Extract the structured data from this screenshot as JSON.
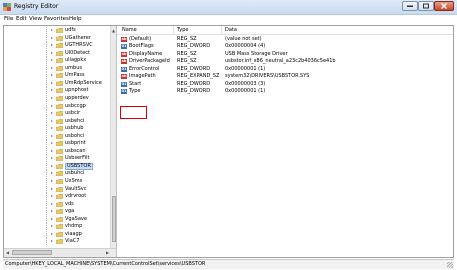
{
  "window": {
    "title": "Registry Editor",
    "menu": [
      "File",
      "Edit",
      "View",
      "Favorites",
      "Help"
    ]
  },
  "tree": {
    "items": [
      {
        "label": "udfs"
      },
      {
        "label": "UGatherer"
      },
      {
        "label": "UGTHRSVC"
      },
      {
        "label": "UI0Detect"
      },
      {
        "label": "uliagpkx"
      },
      {
        "label": "umbus"
      },
      {
        "label": "UmPass"
      },
      {
        "label": "UmRdpService"
      },
      {
        "label": "upnphost"
      },
      {
        "label": "upperdev"
      },
      {
        "label": "usbccgp"
      },
      {
        "label": "usbcir"
      },
      {
        "label": "usbehci"
      },
      {
        "label": "usbhub"
      },
      {
        "label": "usbohci"
      },
      {
        "label": "usbprint"
      },
      {
        "label": "usbscan"
      },
      {
        "label": "UsbserFilt"
      },
      {
        "label": "USBSTOR",
        "selected": true
      },
      {
        "label": "usbuhci"
      },
      {
        "label": "UxSms"
      },
      {
        "label": "VaultSvc"
      },
      {
        "label": "vdrvroot"
      },
      {
        "label": "vds"
      },
      {
        "label": "vga"
      },
      {
        "label": "VgaSave"
      },
      {
        "label": "vhdmp"
      },
      {
        "label": "viaagp"
      },
      {
        "label": "ViaC7"
      }
    ]
  },
  "values_pane": {
    "columns": {
      "name": "Name",
      "type": "Type",
      "data": "Data"
    },
    "rows": [
      {
        "icon": "ab",
        "name": "(Default)",
        "type": "REG_SZ",
        "data": "(value not set)"
      },
      {
        "icon": "bin",
        "name": "BootFlags",
        "type": "REG_DWORD",
        "data": "0x00000004 (4)"
      },
      {
        "icon": "ab",
        "name": "DisplayName",
        "type": "REG_SZ",
        "data": "USB Mass Storage Driver"
      },
      {
        "icon": "ab",
        "name": "DriverPackageId",
        "type": "REG_SZ",
        "data": "usbstor.inf_x86_neutral_a23c2b4036c5e41b"
      },
      {
        "icon": "bin",
        "name": "ErrorControl",
        "type": "REG_DWORD",
        "data": "0x00000001 (1)"
      },
      {
        "icon": "ab",
        "name": "ImagePath",
        "type": "REG_EXPAND_SZ",
        "data": "system32\\DRIVERS\\USBSTOR.SYS"
      },
      {
        "icon": "bin",
        "name": "Start",
        "type": "REG_DWORD",
        "data": "0x00000003 (3)"
      },
      {
        "icon": "bin",
        "name": "Type",
        "type": "REG_DWORD",
        "data": "0x00000001 (1)"
      }
    ]
  },
  "status": {
    "path": "Computer\\HKEY_LOCAL_MACHINE\\SYSTEM\\CurrentControlSet\\services\\USBSTOR"
  },
  "colors": {
    "selection": "#c5dcf6",
    "highlight_box": "#dd0000",
    "close_button": "#c44a2c"
  }
}
